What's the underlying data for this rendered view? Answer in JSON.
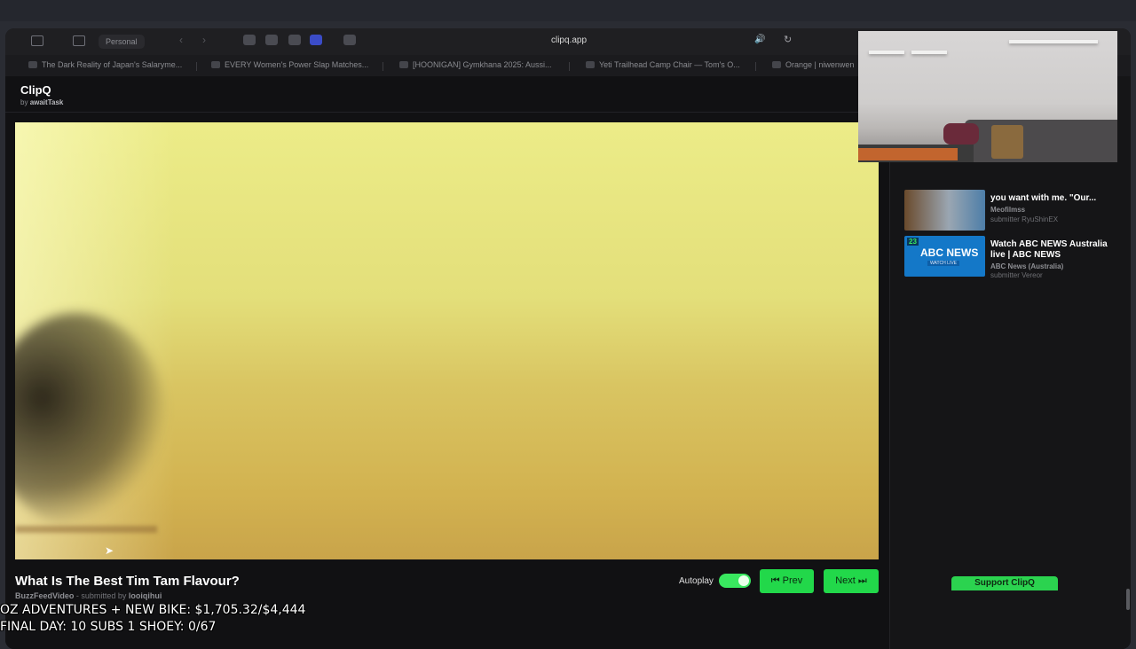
{
  "browser": {
    "profile": "Personal",
    "url": "clipq.app",
    "tabs": [
      "The Dark Reality of Japan's Salaryme...",
      "EVERY Women's Power Slap Matches...",
      "[HOONIGAN] Gymkhana 2025: Aussi...",
      "Yeti Trailhead Camp Chair — Tom's O...",
      "Orange | niwenwen"
    ]
  },
  "app": {
    "title": "ClipQ",
    "by_prefix": "by",
    "by_author": "awaitTask"
  },
  "video": {
    "title": "What Is The Best Tim Tam Flavour?",
    "channel": "BuzzFeedVideo",
    "separator": " - ",
    "submitted_prefix": "submitted by",
    "submitter": "looiqihui"
  },
  "controls": {
    "autoplay_label": "Autoplay",
    "autoplay_on": true,
    "prev_label": "⏮ Prev",
    "next_label": "Next ⏭"
  },
  "related": [
    {
      "title": "you want with me. \"Our...",
      "channel": "Meofilmss",
      "submitter": "submitter RyuShinEX"
    },
    {
      "badge": "23",
      "title": "Watch ABC NEWS Australia live | ABC NEWS",
      "channel": "ABC News (Australia)",
      "submitter": "submitter Vereor",
      "thumb_logo": "ABC NEWS",
      "thumb_sub": "WATCH LIVE"
    }
  ],
  "support_label": "Support ClipQ",
  "stream_overlay": {
    "line1": "OZ ADVENTURES + NEW BIKE: $1,705.32/$4,444",
    "line2": "FINAL DAY: 10 SUBS 1 SHOEY: 0/67"
  },
  "colors": {
    "accent_green": "#22d84a",
    "background": "#111113"
  }
}
